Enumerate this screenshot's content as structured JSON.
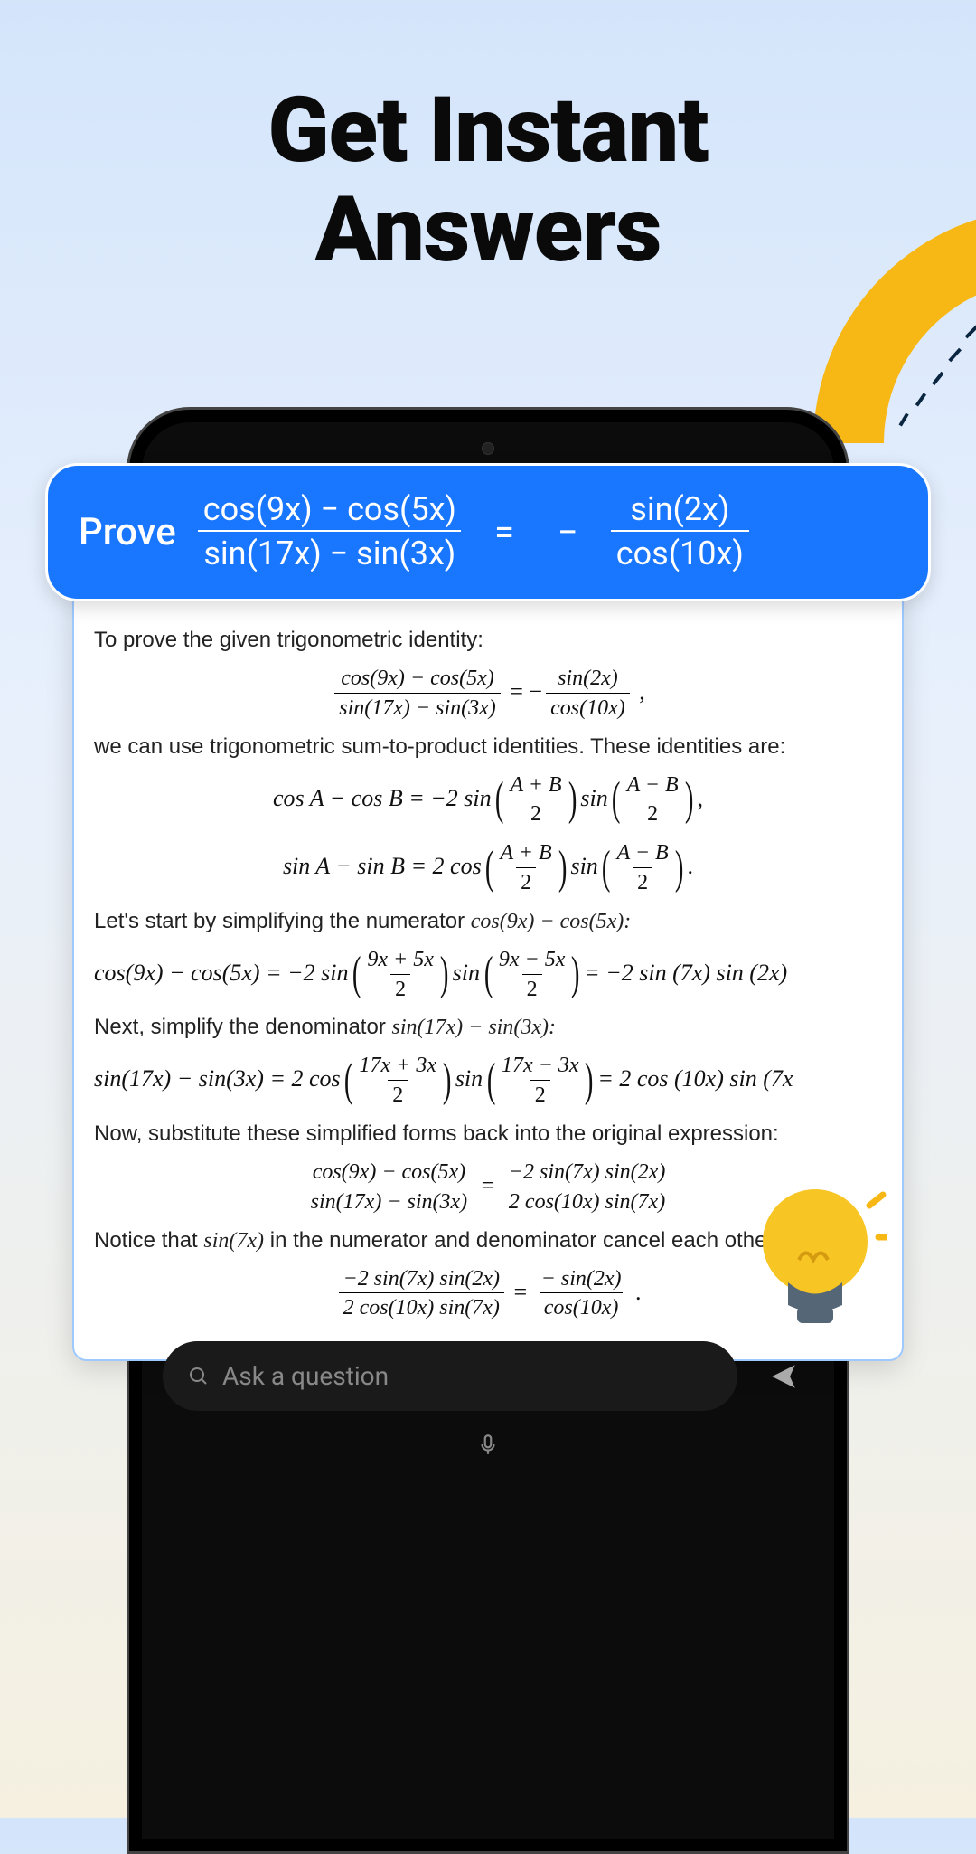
{
  "hero": {
    "line1": "Get Instant",
    "line2": "Answers"
  },
  "question": {
    "prove": "Prove",
    "lhs_num": "cos(9x) − cos(5x)",
    "lhs_den": "sin(17x) − sin(3x)",
    "eq": "=",
    "neg": "−",
    "rhs_num": "sin(2x)",
    "rhs_den": "cos(10x)"
  },
  "answer": {
    "p1": "To prove the given trigonometric identity:",
    "eq1": {
      "lnum": "cos(9x) − cos(5x)",
      "lden": "sin(17x) − sin(3x)",
      "rnum": "sin(2x)",
      "rden": "cos(10x)"
    },
    "p2": "we can use trigonometric sum-to-product identities. These identities are:",
    "id1": {
      "lhs": "cos A − cos B = −2 sin",
      "a": "A + B",
      "b": "A − B"
    },
    "id2": {
      "lhs": "sin A − sin B = 2 cos",
      "a": "A + B",
      "b": "A − B"
    },
    "p3_a": "Let's start by simplifying the numerator ",
    "p3_b": "cos(9x) − cos(5x):",
    "step1": {
      "lhs": "cos(9x) − cos(5x) = −2 sin",
      "a": "9x + 5x",
      "b": "9x − 5x",
      "rhs": " = −2 sin (7x) sin (2x)"
    },
    "p4_a": "Next, simplify the denominator ",
    "p4_b": "sin(17x) − sin(3x):",
    "step2": {
      "lhs": "sin(17x) − sin(3x) = 2 cos",
      "a": "17x + 3x",
      "b": "17x − 3x",
      "rhs": " = 2 cos (10x) sin (7x"
    },
    "p5": "Now, substitute these simplified forms back into the original expression:",
    "eq2": {
      "lnum": "cos(9x) − cos(5x)",
      "lden": "sin(17x) − sin(3x)",
      "rnum": "−2 sin(7x) sin(2x)",
      "rden": "2 cos(10x) sin(7x)"
    },
    "p6_a": "Notice that ",
    "p6_b": "sin(7x)",
    "p6_c": " in the numerator and denominator cancel each other ",
    "eq3": {
      "lnum": "−2 sin(7x) sin(2x)",
      "lden": "2 cos(10x) sin(7x)",
      "rnum": "− sin(2x)",
      "rden": "cos(10x)"
    }
  },
  "input": {
    "placeholder": "Ask a question"
  },
  "half": "2",
  "sin": " sin "
}
